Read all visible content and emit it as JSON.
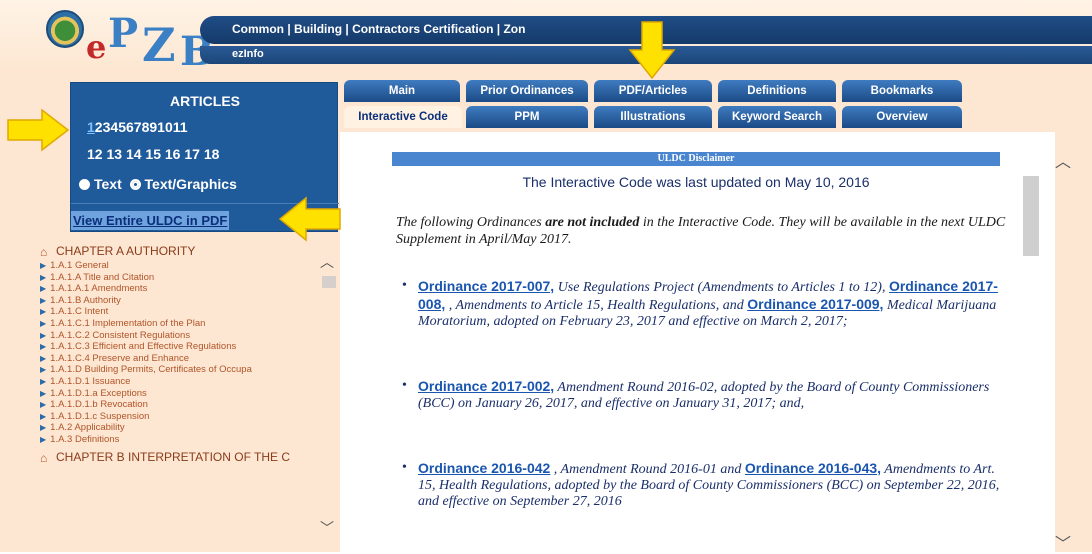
{
  "header": {
    "logo_letters": [
      "e",
      "P",
      "Z",
      "B"
    ],
    "nav_links": [
      "Common",
      "Building",
      "Contractors Certification",
      "Zon"
    ],
    "sub_link": "ezInfo"
  },
  "articles": {
    "title": "ARTICLES",
    "row1": [
      "1",
      "2",
      "3",
      "4",
      "5",
      "6",
      "7",
      "8",
      "9",
      "10",
      "11"
    ],
    "row2": [
      "12",
      "13",
      "14",
      "15",
      "16",
      "17",
      "18"
    ],
    "selected": "1",
    "view_text": "Text",
    "view_graphics": "Text/Graphics",
    "view_pdf": "View Entire ULDC in PDF"
  },
  "toc": {
    "chapter_a": "CHAPTER A AUTHORITY",
    "items": [
      "1.A.1 General",
      "1.A.1.A Title and Citation",
      "1.A.1.A.1 Amendments",
      "1.A.1.B Authority",
      "1.A.1.C Intent",
      "1.A.1.C.1 Implementation of the Plan",
      "1.A.1.C.2 Consistent Regulations",
      "1.A.1.C.3 Efficient and Effective Regulations",
      "1.A.1.C.4 Preserve and Enhance",
      "1.A.1.D Building Permits, Certificates of Occupa",
      "1.A.1.D.1 Issuance",
      "1.A.1.D.1.a Exceptions",
      "1.A.1.D.1.b Revocation",
      "1.A.1.D.1.c Suspension",
      "1.A.2 Applicability",
      "1.A.3 Definitions"
    ],
    "chapter_b": "CHAPTER B INTERPRETATION OF THE C"
  },
  "tabs": {
    "row1": [
      "Main",
      "Prior Ordinances",
      "PDF/Articles",
      "Definitions",
      "Bookmarks"
    ],
    "row2": [
      "Interactive Code",
      "PPM",
      "Illustrations",
      "Keyword Search",
      "Overview"
    ],
    "active": "Interactive Code"
  },
  "content": {
    "disclaimer_title": "ULDC Disclaimer",
    "updated": "The Interactive Code was last updated on May 10, 2016",
    "intro_pre": "The following Ordinances ",
    "intro_bold": "are not included",
    "intro_post": " in the Interactive Code. They will be available in the next ULDC Supplement in April/May 2017.",
    "ord1_link1": "Ordinance 2017-007,",
    "ord1_text1": " Use Regulations Project (Amendments to Articles 1 to 12), ",
    "ord1_link2": "Ordinance 2017-008,",
    "ord1_text2": " , Amendments to Article 15, Health Regulations, and ",
    "ord1_link3": "Ordinance 2017-009,",
    "ord1_text3": " Medical Marijuana Moratorium, adopted on February 23, 2017 and effective on March 2, 2017;",
    "ord2_link": "Ordinance 2017-002,",
    "ord2_text": " Amendment Round 2016-02, adopted by the Board of County Commissioners (BCC) on January 26, 2017, and effective on January 31, 2017; and,",
    "ord3_link1": "Ordinance 2016-042",
    "ord3_text1": " , Amendment Round 2016-01 and ",
    "ord3_link2": "Ordinance 2016-043,",
    "ord3_text2": " Amendments to Art. 15, Health Regulations, adopted by the Board of County Commissioners (BCC) on September 22, 2016, and effective on September 27, 2016"
  },
  "colors": {
    "nav_blue": "#1f4d86",
    "panel_bg": "#fde7d2",
    "articles_blue": "#1f5a9a",
    "arrow_yellow": "#ffe100"
  }
}
